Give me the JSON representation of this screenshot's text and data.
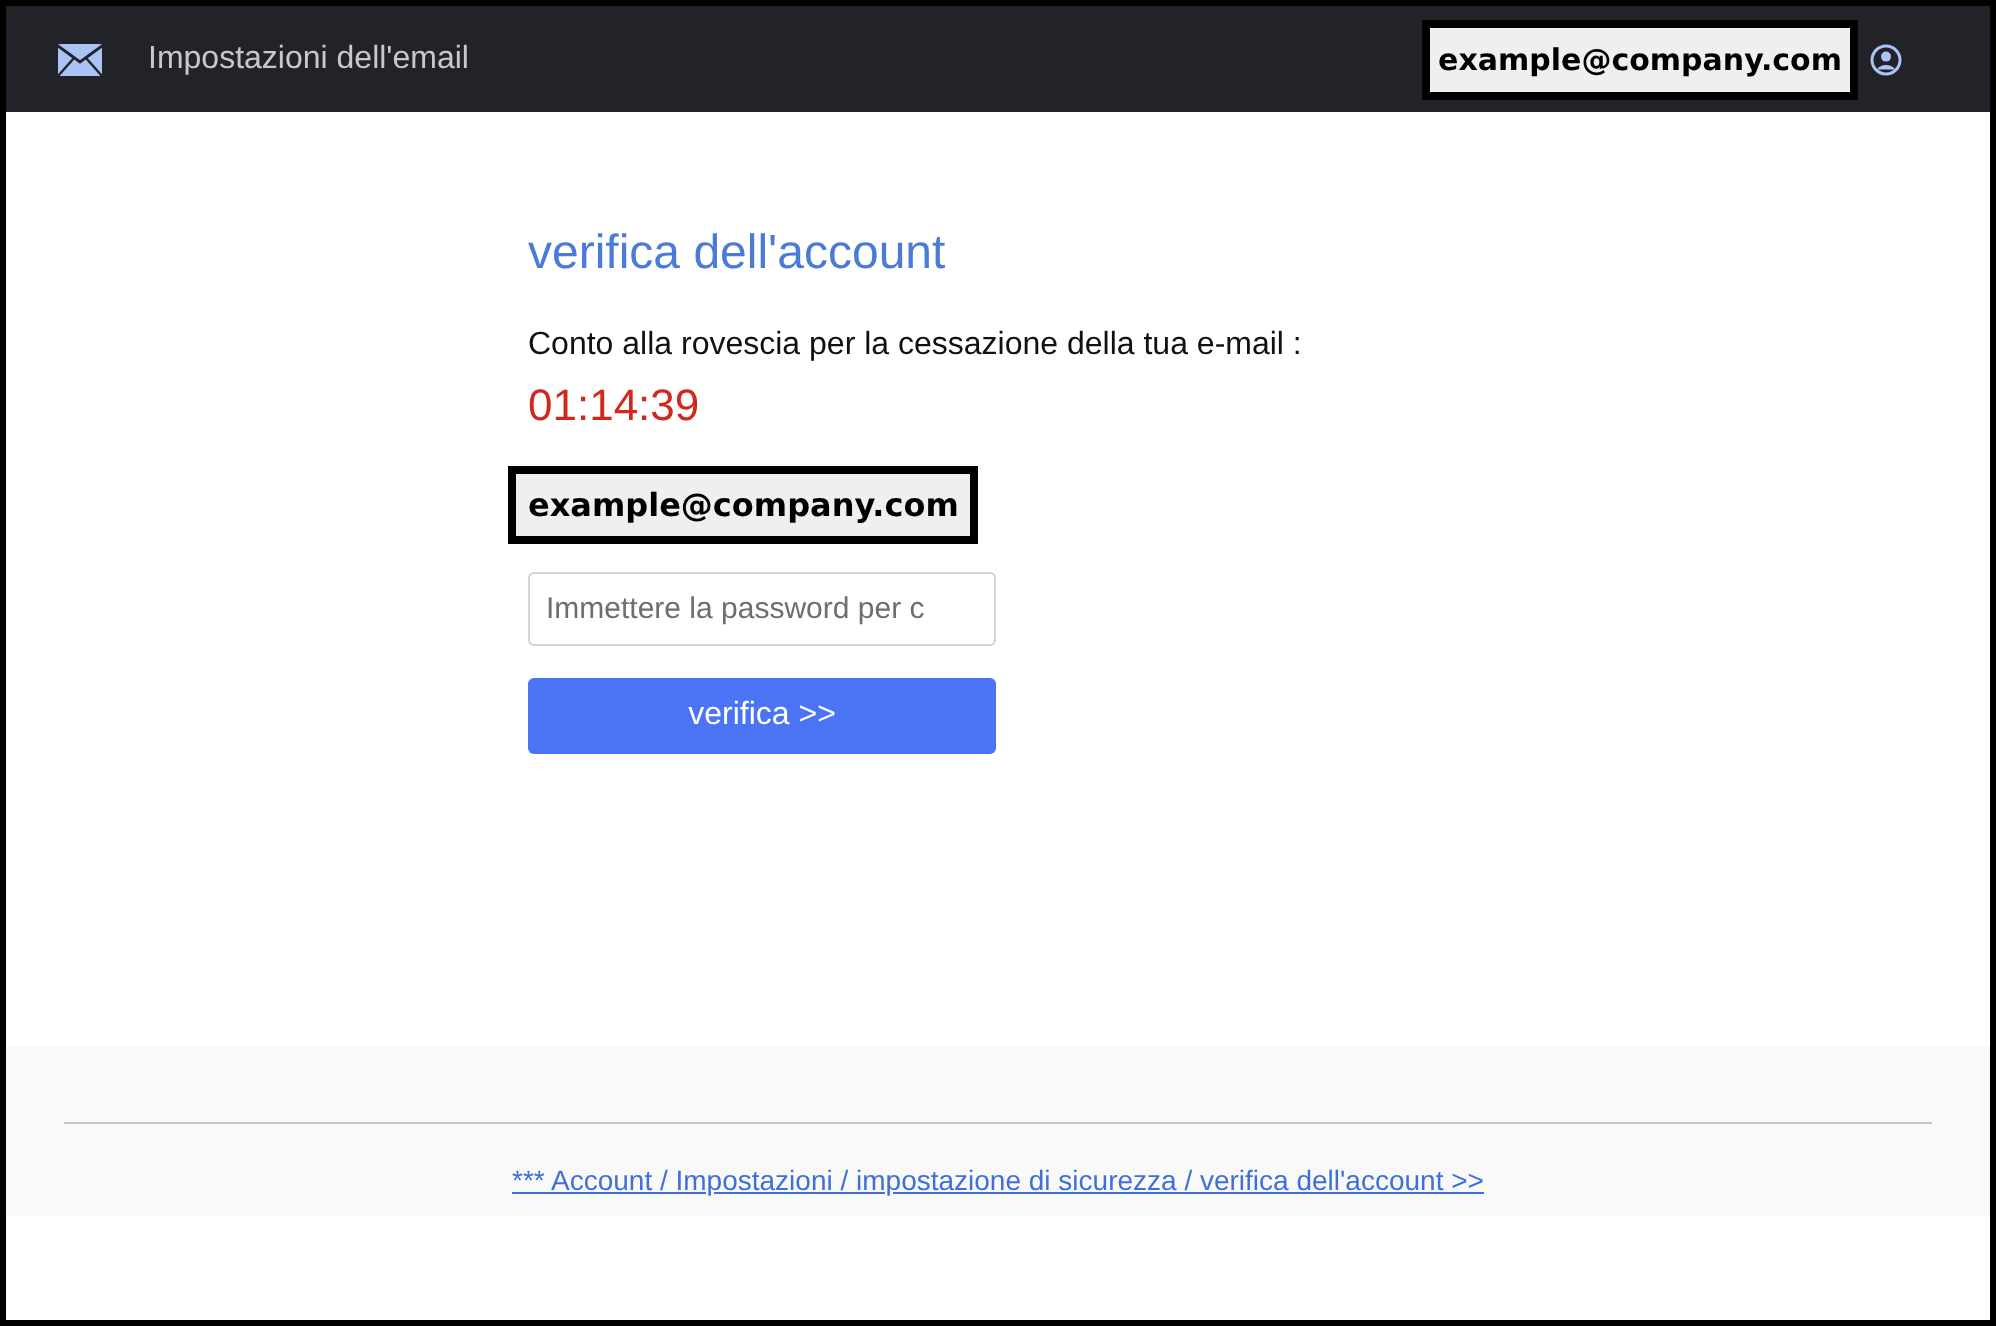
{
  "header": {
    "title": "Impostazioni dell'email",
    "account_email": "example@company.com"
  },
  "main": {
    "heading": "verifica dell'account",
    "message": "Conto alla rovescia per la cessazione della tua e-mail :",
    "countdown": "01:14:39",
    "email": "example@company.com",
    "password": {
      "placeholder": "Immettere la password per c"
    },
    "button": "verifica >>"
  },
  "footer": {
    "link": "*** Account / Impostazioni / impostazione di sicurezza / verifica dell'account >>"
  }
}
